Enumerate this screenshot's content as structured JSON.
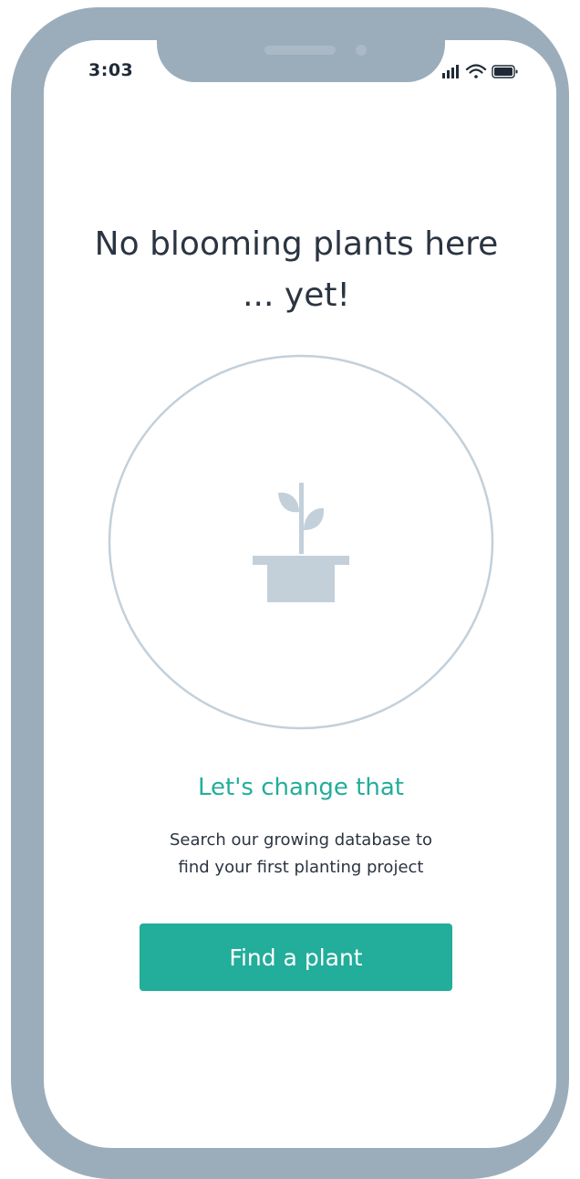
{
  "status_bar": {
    "time": "3:03",
    "icons": [
      "signal-icon",
      "wifi-icon",
      "battery-icon"
    ]
  },
  "empty_state": {
    "title_line1": "No blooming plants here",
    "title_line2": "... yet!",
    "illustration_icon": "potted-seedling-icon",
    "subheading": "Let's change that",
    "description_line1": "Search our growing database to",
    "description_line2": "find your first planting project"
  },
  "cta": {
    "label": "Find a plant"
  },
  "colors": {
    "accent": "#23ad9b",
    "frame": "#9badbb",
    "text": "#2b3441",
    "illustration": "#c3d0da"
  }
}
